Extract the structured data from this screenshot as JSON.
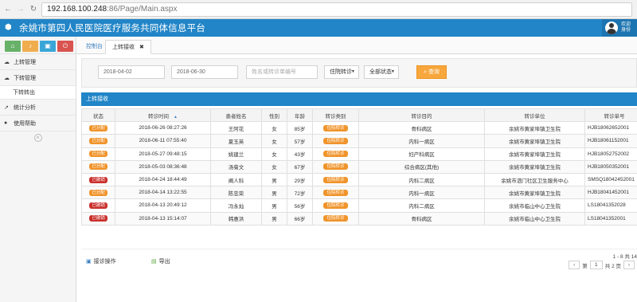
{
  "browser": {
    "url_host": "192.168.100.248",
    "url_path": ":86/Page/Main.aspx"
  },
  "header": {
    "title": "余姚市第四人民医院医疗服务共同体信息平台",
    "user_line1": "欢迎",
    "user_line2": "身份"
  },
  "sidebar": {
    "shortcuts": [
      "home-icon",
      "bell-icon",
      "save-icon",
      "power-icon"
    ],
    "items": [
      {
        "label": "上转管理",
        "icon": "cloud-upload-icon"
      },
      {
        "label": "下转管理",
        "icon": "cloud-download-icon"
      },
      {
        "label": "下转转出"
      },
      {
        "label": "统计分析",
        "icon": "chart-icon"
      },
      {
        "label": "使用帮助",
        "icon": "info-icon"
      }
    ]
  },
  "tabs": [
    {
      "label": "控制台"
    },
    {
      "label": "上转接收"
    }
  ],
  "filters": {
    "start_date": "2018-04-02",
    "end_date": "2018-06-30",
    "search_placeholder": "姓名或转诊单编号",
    "type_select": "住院转诊",
    "status_select": "全部状态",
    "query_button": "查询"
  },
  "panel_title": "上转接收",
  "table": {
    "headers": [
      "状态",
      "转诊时间",
      "患者姓名",
      "性别",
      "年龄",
      "转诊类别",
      "转诊目的",
      "转诊单位",
      "转诊单号"
    ],
    "rows": [
      {
        "status": "已分配",
        "status_color": "#f0942b",
        "time": "2018-06-26 08:27:26",
        "name": "王阿花",
        "sex": "女",
        "age": "85岁",
        "type": "住院转诊",
        "dest": "骨科病区",
        "unit": "余姚市黄家埠镇卫生院",
        "no": "HJB18062652001"
      },
      {
        "status": "已分配",
        "status_color": "#f0942b",
        "time": "2018-06-11 07:55:40",
        "name": "夏玉英",
        "sex": "女",
        "age": "57岁",
        "type": "住院转诊",
        "dest": "内科一病区",
        "unit": "余姚市黄家埠镇卫生院",
        "no": "HJB18061152001"
      },
      {
        "status": "已分配",
        "status_color": "#f0942b",
        "time": "2018-05-27 09:48:15",
        "name": "姚建兰",
        "sex": "女",
        "age": "43岁",
        "type": "住院转诊",
        "dest": "妇产科病区",
        "unit": "余姚市黄家埠镇卫生院",
        "no": "HJB18052752002"
      },
      {
        "status": "已分配",
        "status_color": "#f0942b",
        "time": "2018-05-03 08:36:48",
        "name": "汤菊文",
        "sex": "女",
        "age": "67岁",
        "type": "住院转诊",
        "dest": "综合病区(其他)",
        "unit": "余姚市黄家埠镇卫生院",
        "no": "HJB18050352001"
      },
      {
        "status": "已撤销",
        "status_color": "#c9302c",
        "time": "2018-04-24 18:44:49",
        "name": "阐人科",
        "sex": "男",
        "age": "29岁",
        "type": "住院转诊",
        "dest": "内科二病区",
        "unit": "余姚市泗门社区卫生服务中心",
        "no": "SMSQ18042452001"
      },
      {
        "status": "已分配",
        "status_color": "#f0942b",
        "time": "2018-04-14 13:22:55",
        "name": "陈忠荣",
        "sex": "男",
        "age": "72岁",
        "type": "住院转诊",
        "dest": "内科一病区",
        "unit": "余姚市黄家埠镇卫生院",
        "no": "HJB18041452001"
      },
      {
        "status": "已撤销",
        "status_color": "#c9302c",
        "time": "2018-04-13 20:49:12",
        "name": "冯永灿",
        "sex": "男",
        "age": "56岁",
        "type": "住院转诊",
        "dest": "内科二病区",
        "unit": "余姚市临山中心卫生院",
        "no": "LS18041352028"
      },
      {
        "status": "已撤销",
        "status_color": "#c9302c",
        "time": "2018-04-13 15:14:07",
        "name": "韩惠洪",
        "sex": "男",
        "age": "66岁",
        "type": "住院转诊",
        "dest": "骨科病区",
        "unit": "余姚市临山中心卫生院",
        "no": "LS18041352001"
      }
    ]
  },
  "footer": {
    "action1": "接诊操作",
    "action2": "导出",
    "range": "1 - 8",
    "total": "共 14",
    "page_prefix": "第",
    "page": "1",
    "page_count": "共 2 页"
  }
}
